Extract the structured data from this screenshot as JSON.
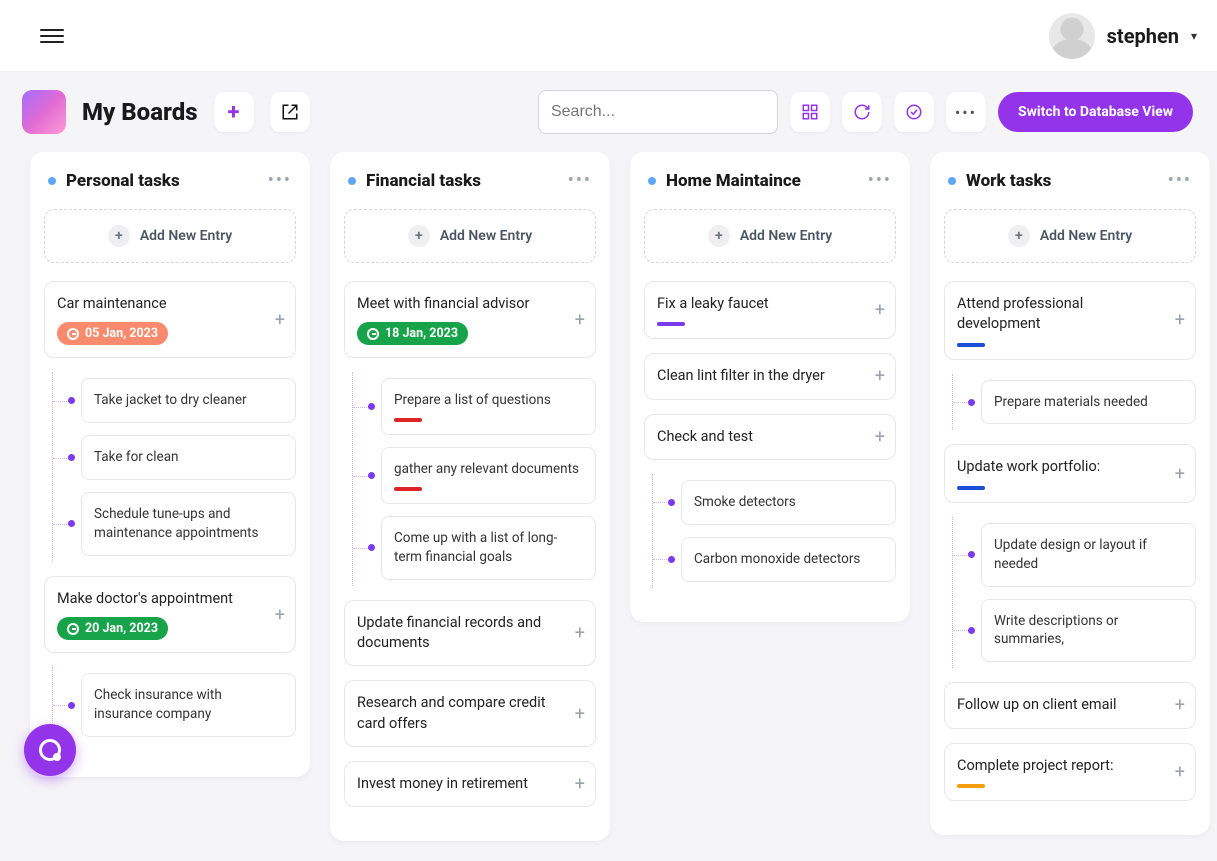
{
  "user": {
    "name": "stephen"
  },
  "page_title": "My Boards",
  "search": {
    "placeholder": "Search..."
  },
  "switch_btn": "Switch to Database View",
  "add_entry_label": "Add New Entry",
  "columns": [
    {
      "title": "Personal tasks",
      "cards": [
        {
          "title": "Car maintenance",
          "date": "05 Jan, 2023",
          "date_color": "salmon",
          "subs": [
            {
              "title": "Take jacket to dry cleaner"
            },
            {
              "title": "Take for clean"
            },
            {
              "title": "Schedule tune-ups and maintenance appointments"
            }
          ]
        },
        {
          "title": "Make doctor's appointment",
          "date": "20 Jan, 2023",
          "date_color": "green",
          "subs": [
            {
              "title": "Check insurance with insurance company"
            }
          ]
        }
      ]
    },
    {
      "title": "Financial tasks",
      "cards": [
        {
          "title": "Meet with financial advisor",
          "date": "18 Jan, 2023",
          "date_color": "green",
          "subs": [
            {
              "title": "Prepare a list of questions",
              "stripe": "red-s"
            },
            {
              "title": "gather any relevant documents",
              "stripe": "red-s"
            },
            {
              "title": "Come up with a list of long-term financial goals"
            }
          ]
        },
        {
          "title": "Update financial records and documents"
        },
        {
          "title": "Research and compare credit card offers"
        },
        {
          "title": "Invest money in retirement"
        }
      ]
    },
    {
      "title": "Home Maintaince",
      "cards": [
        {
          "title": "Fix a leaky faucet",
          "stripe": "purple-s"
        },
        {
          "title": "Clean lint filter in the dryer"
        },
        {
          "title": "Check and test",
          "subs": [
            {
              "title": "Smoke detectors"
            },
            {
              "title": "Carbon monoxide detectors"
            }
          ]
        }
      ]
    },
    {
      "title": "Work tasks",
      "cards": [
        {
          "title": "Attend professional development",
          "stripe": "blue-s",
          "subs": [
            {
              "title": "Prepare materials needed"
            }
          ]
        },
        {
          "title": "Update work portfolio:",
          "stripe": "blue-s",
          "subs": [
            {
              "title": "Update design or layout if needed"
            },
            {
              "title": "Write descriptions or summaries,"
            }
          ]
        },
        {
          "title": "Follow up on client email"
        },
        {
          "title": "Complete project report:",
          "stripe": "orange-s"
        }
      ]
    }
  ]
}
